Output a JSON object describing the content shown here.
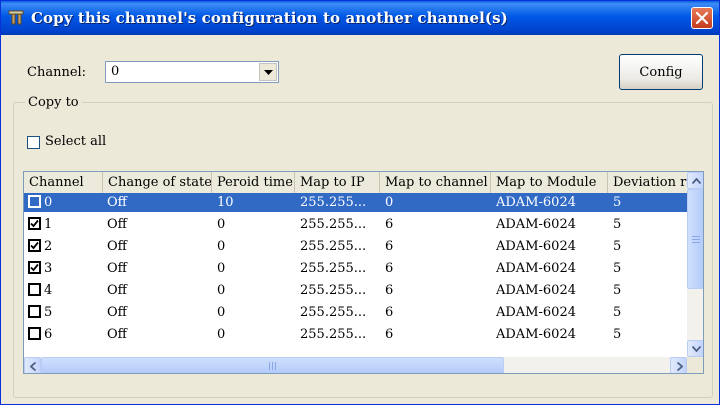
{
  "window": {
    "title": "Copy this channel's configuration to another channel(s)",
    "close_label": "×"
  },
  "channel": {
    "label": "Channel:",
    "value": "0"
  },
  "config_button": "Config",
  "copy_to": {
    "group_label": "Copy to",
    "select_all_label": "Select all",
    "select_all_checked": false
  },
  "table": {
    "columns": [
      "Channel",
      "Change of state",
      "Peroid time",
      "Map to IP",
      "Map to channel",
      "Map to Module",
      "Deviation ra"
    ],
    "rows": [
      {
        "checked": false,
        "selected": true,
        "channel": "0",
        "change_of_state": "Off",
        "period_time": "10",
        "map_to_ip": "255.255...",
        "map_to_channel": "0",
        "map_to_module": "ADAM-6024",
        "deviation": "5"
      },
      {
        "checked": true,
        "selected": false,
        "channel": "1",
        "change_of_state": "Off",
        "period_time": "0",
        "map_to_ip": "255.255...",
        "map_to_channel": "6",
        "map_to_module": "ADAM-6024",
        "deviation": "5"
      },
      {
        "checked": true,
        "selected": false,
        "channel": "2",
        "change_of_state": "Off",
        "period_time": "0",
        "map_to_ip": "255.255...",
        "map_to_channel": "6",
        "map_to_module": "ADAM-6024",
        "deviation": "5"
      },
      {
        "checked": true,
        "selected": false,
        "channel": "3",
        "change_of_state": "Off",
        "period_time": "0",
        "map_to_ip": "255.255...",
        "map_to_channel": "6",
        "map_to_module": "ADAM-6024",
        "deviation": "5"
      },
      {
        "checked": false,
        "selected": false,
        "channel": "4",
        "change_of_state": "Off",
        "period_time": "0",
        "map_to_ip": "255.255...",
        "map_to_channel": "6",
        "map_to_module": "ADAM-6024",
        "deviation": "5"
      },
      {
        "checked": false,
        "selected": false,
        "channel": "5",
        "change_of_state": "Off",
        "period_time": "0",
        "map_to_ip": "255.255...",
        "map_to_channel": "6",
        "map_to_module": "ADAM-6024",
        "deviation": "5"
      },
      {
        "checked": false,
        "selected": false,
        "channel": "6",
        "change_of_state": "Off",
        "period_time": "0",
        "map_to_ip": "255.255...",
        "map_to_channel": "6",
        "map_to_module": "ADAM-6024",
        "deviation": "5"
      }
    ]
  },
  "colors": {
    "title_bar": "#0054e3",
    "selection": "#316ac5",
    "dialog_face": "#ece9d8",
    "close_button": "#d7542f"
  },
  "icons": {
    "app": "tools-icon",
    "close": "close-icon",
    "combo": "chevron-down-icon",
    "scroll_up": "chevron-up-icon",
    "scroll_down": "chevron-down-icon",
    "scroll_left": "chevron-left-icon",
    "scroll_right": "chevron-right-icon"
  }
}
